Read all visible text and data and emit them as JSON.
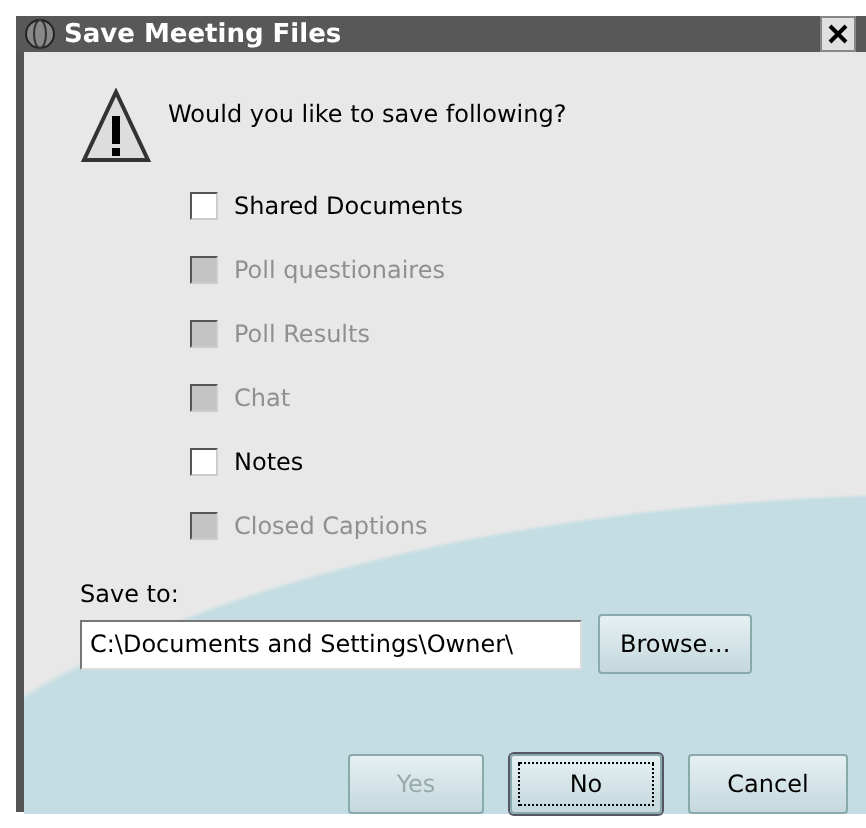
{
  "window": {
    "title": "Save Meeting Files"
  },
  "prompt": "Would you like to save following?",
  "options": [
    {
      "label": "Shared Documents",
      "checked": false,
      "disabled": false
    },
    {
      "label": "Poll questionaires",
      "checked": false,
      "disabled": true
    },
    {
      "label": "Poll Results",
      "checked": false,
      "disabled": true
    },
    {
      "label": "Chat",
      "checked": false,
      "disabled": true
    },
    {
      "label": "Notes",
      "checked": false,
      "disabled": false
    },
    {
      "label": "Closed Captions",
      "checked": false,
      "disabled": true
    }
  ],
  "save_to": {
    "label": "Save to:",
    "value": "C:\\Documents and Settings\\Owner\\",
    "browse": "Browse..."
  },
  "buttons": [
    {
      "label": "Yes",
      "disabled": true,
      "selected": false
    },
    {
      "label": "No",
      "disabled": false,
      "selected": true
    },
    {
      "label": "Cancel",
      "disabled": false,
      "selected": false
    }
  ]
}
